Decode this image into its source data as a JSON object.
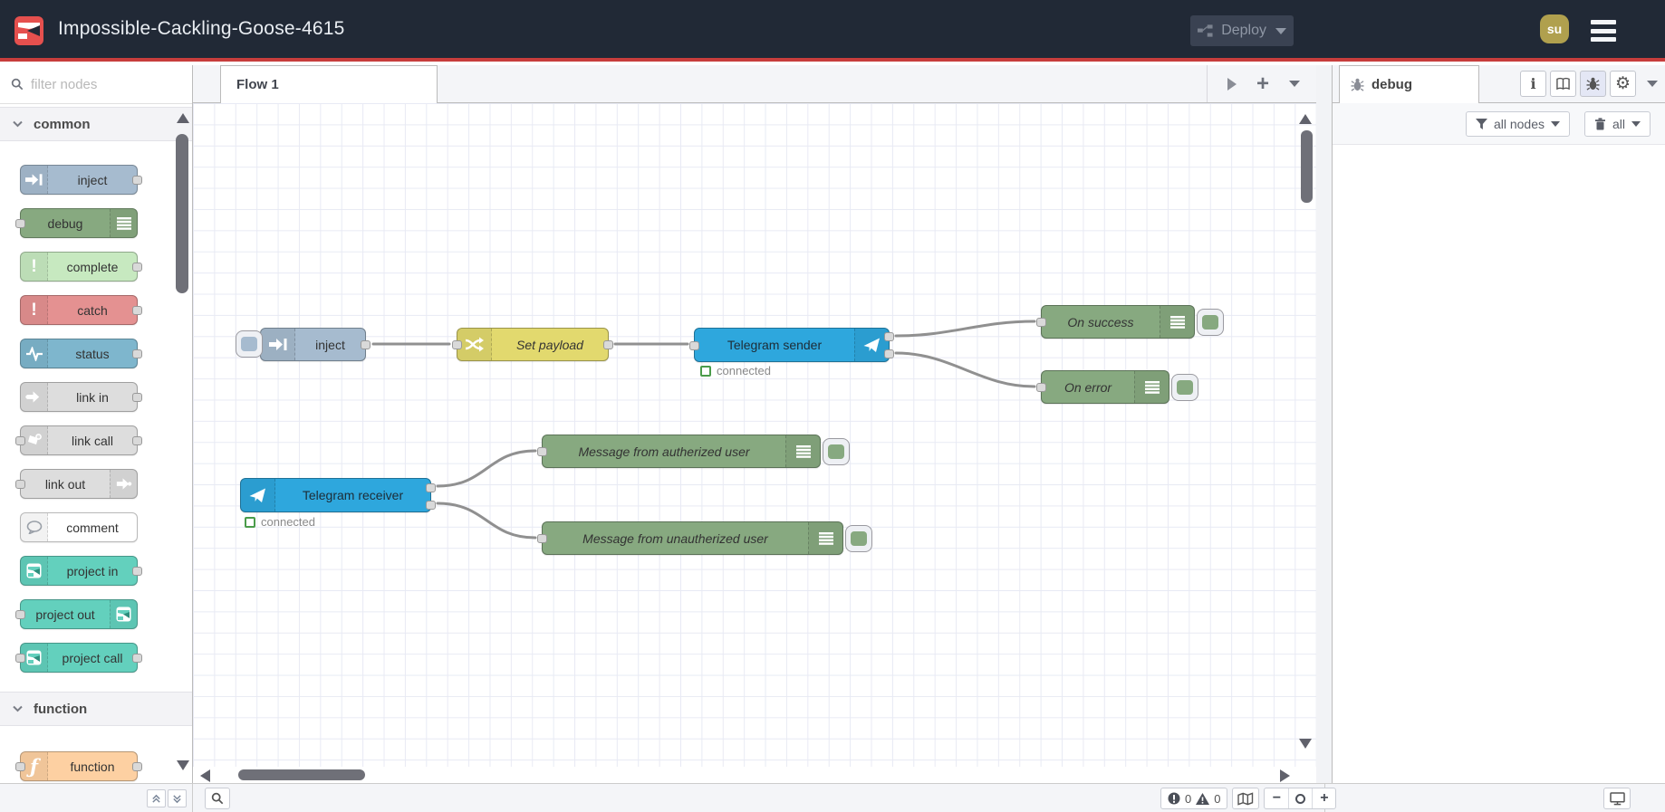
{
  "header": {
    "title": "Impossible-Cackling-Goose-4615",
    "deploy": {
      "label": "Deploy"
    },
    "avatar": {
      "initials": "su"
    },
    "colors": {
      "background": "#212936",
      "accent_line": "#c73d3c",
      "logo_red": "#e5504e",
      "avatar_gold": "#b0a04e"
    }
  },
  "palette": {
    "filter_placeholder": "filter nodes",
    "categories": [
      {
        "label": "common",
        "nodes": [
          {
            "label": "inject",
            "color": "#a6bbcf"
          },
          {
            "label": "debug",
            "color": "#87a980"
          },
          {
            "label": "complete",
            "color": "#c7e9c0"
          },
          {
            "label": "catch",
            "color": "#e49191"
          },
          {
            "label": "status",
            "color": "#7eb6cd"
          },
          {
            "label": "link in",
            "color": "#dddddd"
          },
          {
            "label": "link call",
            "color": "#dddddd"
          },
          {
            "label": "link out",
            "color": "#dddddd"
          },
          {
            "label": "comment",
            "color": "#ffffff"
          },
          {
            "label": "project in",
            "color": "#63d0bd"
          },
          {
            "label": "project out",
            "color": "#63d0bd"
          },
          {
            "label": "project call",
            "color": "#63d0bd"
          }
        ]
      },
      {
        "label": "function",
        "nodes": [
          {
            "label": "function",
            "color": "#fdd0a2"
          }
        ]
      }
    ]
  },
  "workspace": {
    "tab": "Flow 1",
    "nodes": [
      {
        "label": "inject",
        "color": "#a6bbcf"
      },
      {
        "label": "Set payload",
        "color": "#e2d96e"
      },
      {
        "label": "Telegram sender",
        "color": "#2ea7dd",
        "status": "connected"
      },
      {
        "label": "On success",
        "color": "#87a980"
      },
      {
        "label": "On error",
        "color": "#87a980"
      },
      {
        "label": "Telegram receiver",
        "color": "#2ea7dd",
        "status": "connected"
      },
      {
        "label": "Message from autherized user",
        "color": "#87a980"
      },
      {
        "label": "Message from unautherized user",
        "color": "#87a980"
      }
    ]
  },
  "sidebar": {
    "tab": "debug",
    "filter_label": "all nodes",
    "clear_label": "all"
  },
  "statusbar": {
    "error_count": "0",
    "warning_count": "0"
  }
}
